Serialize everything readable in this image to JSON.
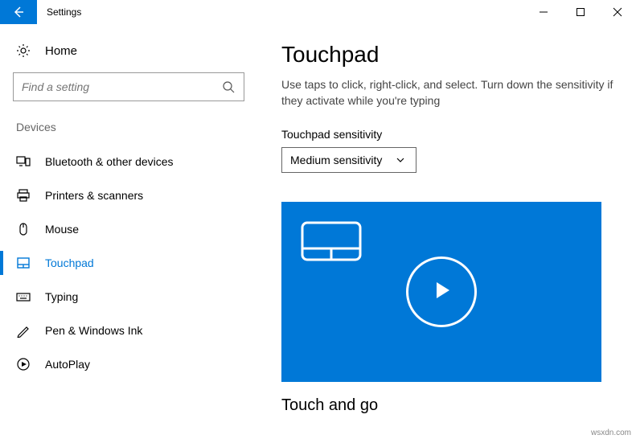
{
  "titlebar": {
    "title": "Settings"
  },
  "sidebar": {
    "home_label": "Home",
    "search_placeholder": "Find a setting",
    "section_header": "Devices",
    "items": [
      {
        "label": "Bluetooth & other devices"
      },
      {
        "label": "Printers & scanners"
      },
      {
        "label": "Mouse"
      },
      {
        "label": "Touchpad"
      },
      {
        "label": "Typing"
      },
      {
        "label": "Pen & Windows Ink"
      },
      {
        "label": "AutoPlay"
      }
    ]
  },
  "main": {
    "title": "Touchpad",
    "description": "Use taps to click, right-click, and select. Turn down the sensitivity if they activate while you're typing",
    "sensitivity_label": "Touchpad sensitivity",
    "sensitivity_value": "Medium sensitivity",
    "section_title": "Touch and go"
  },
  "watermark": "wsxdn.com"
}
